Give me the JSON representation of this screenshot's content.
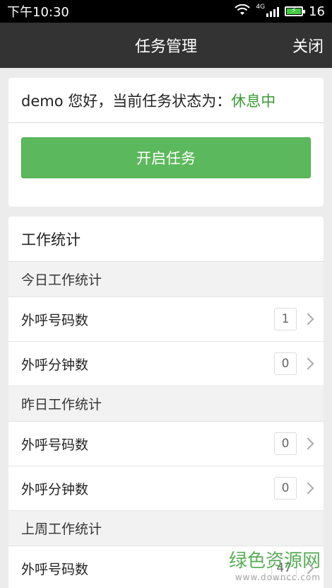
{
  "statusbar": {
    "time": "下午10:30",
    "network": "4G",
    "battery": "16"
  },
  "navbar": {
    "title": "任务管理",
    "close_label": "关闭"
  },
  "greeting": {
    "text": "demo 您好，当前任务状态为：",
    "status": "休息中",
    "status_color": "#3a9a33"
  },
  "start_button": {
    "label": "开启任务",
    "color": "#5cb85c"
  },
  "stats": {
    "title": "工作统计",
    "today": {
      "header": "今日工作统计",
      "rows": [
        {
          "label": "外呼号码数",
          "count": "1"
        },
        {
          "label": "外呼分钟数",
          "count": "0"
        }
      ]
    },
    "yesterday": {
      "header": "昨日工作统计",
      "rows": [
        {
          "label": "外呼号码数",
          "count": "0"
        },
        {
          "label": "外呼分钟数",
          "count": "0"
        }
      ]
    },
    "lastweek": {
      "header": "上周工作统计",
      "rows": [
        {
          "label": "外呼号码数",
          "count": "47"
        }
      ]
    }
  },
  "watermark": {
    "text": "绿色资源网",
    "url": "www.downcc.com"
  }
}
